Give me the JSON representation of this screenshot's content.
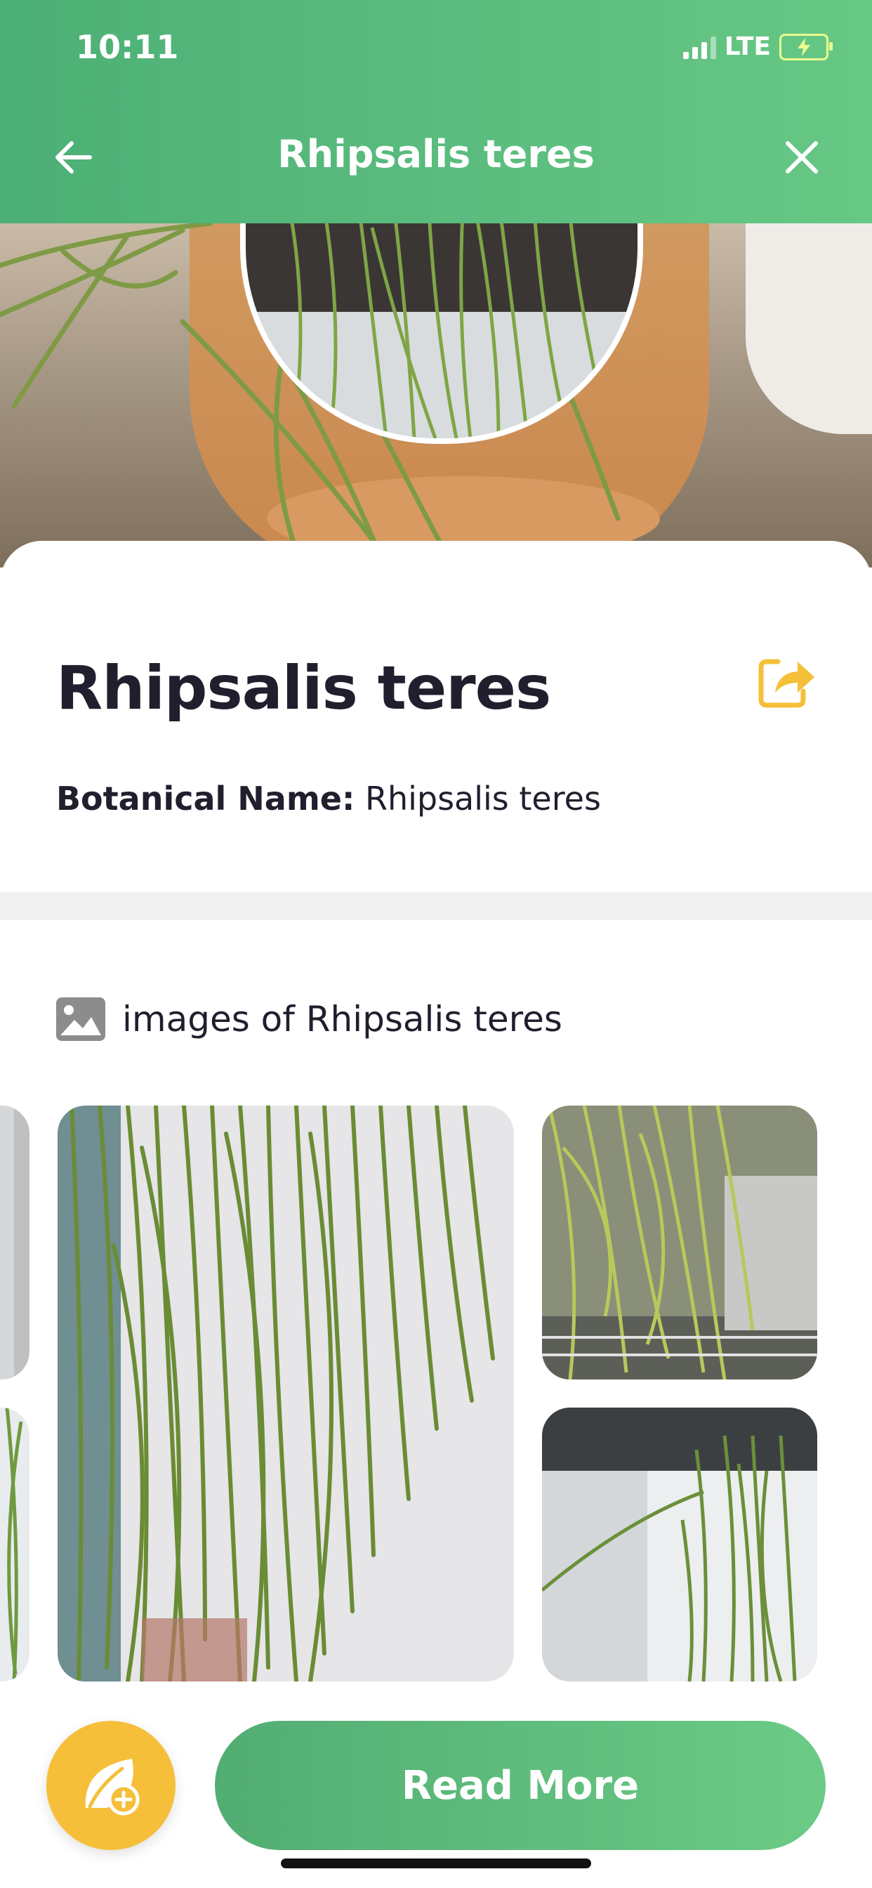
{
  "status_bar": {
    "time": "10:11",
    "network": "LTE"
  },
  "header": {
    "title": "Rhipsalis teres"
  },
  "plant": {
    "name": "Rhipsalis teres",
    "botanical_label": "Botanical Name:",
    "botanical_value": "Rhipsalis teres"
  },
  "images": {
    "heading_prefix": "images of",
    "heading_name": "Rhipsalis teres"
  },
  "actions": {
    "read_more": "Read More"
  },
  "colors": {
    "header_green": "#5bbd7c",
    "accent_yellow": "#f5bf3a",
    "title_text": "#1f1f2e"
  },
  "icons": {
    "back": "arrow-left-icon",
    "close": "close-icon",
    "share": "share-icon",
    "gallery": "image-icon",
    "add_plant": "leaf-plus-icon"
  }
}
